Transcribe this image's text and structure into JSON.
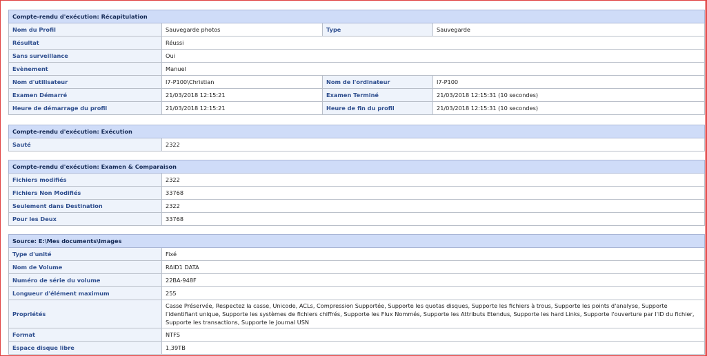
{
  "summary": {
    "header": "Compte-rendu d'exécution: Récapitulation",
    "rows": [
      {
        "l1": "Nom du Profil",
        "v1": "Sauvegarde photos",
        "l2": "Type",
        "v2": "Sauvegarde"
      },
      {
        "l1": "Résultat",
        "v1": "Réussi"
      },
      {
        "l1": "Sans surveillance",
        "v1": "Oui"
      },
      {
        "l1": "Evènement",
        "v1": "Manuel"
      },
      {
        "l1": "Nom d'utilisateur",
        "v1": "I7-P100\\Christian",
        "l2": "Nom de l'ordinateur",
        "v2": "I7-P100"
      },
      {
        "l1": "Examen Démarré",
        "v1": "21/03/2018 12:15:21",
        "l2": "Examen Terminé",
        "v2": "21/03/2018 12:15:31 (10 secondes)"
      },
      {
        "l1": "Heure de démarrage du profil",
        "v1": "21/03/2018 12:15:21",
        "l2": "Heure de fin du profil",
        "v2": "21/03/2018 12:15:31 (10 secondes)"
      }
    ]
  },
  "execution": {
    "header": "Compte-rendu d'exécution: Exécution",
    "rows": [
      {
        "l1": "Sauté",
        "v1": "2322"
      }
    ]
  },
  "compare": {
    "header": "Compte-rendu d'exécution: Examen & Comparaison",
    "rows": [
      {
        "l1": "Fichiers modifiés",
        "v1": "2322"
      },
      {
        "l1": "Fichiers Non Modifiés",
        "v1": "33768"
      },
      {
        "l1": "Seulement dans Destination",
        "v1": "2322"
      },
      {
        "l1": "Pour les Deux",
        "v1": "33768"
      }
    ]
  },
  "source": {
    "header": "Source: E:\\Mes documents\\Images",
    "rows": [
      {
        "l1": "Type d'unité",
        "v1": "Fixé"
      },
      {
        "l1": "Nom de Volume",
        "v1": "RAID1 DATA"
      },
      {
        "l1": "Numéro de série du volume",
        "v1": "22BA-948F"
      },
      {
        "l1": "Longueur d'élément maximum",
        "v1": "255"
      },
      {
        "l1": "Propriétés",
        "v1": "Casse Préservée, Respectez la casse, Unicode, ACLs, Compression Supportée, Supporte les quotas disques, Supporte les fichiers à trous, Supporte les points d'analyse, Supporte l'identifiant unique, Supporte les systèmes de fichiers chiffrés, Supporte les Flux Nommés, Supporte les Attributs Etendus, Supporte les hard Links, Supporte l'ouverture par l'ID du fichier, Supporte les transactions, Supporte le Journal USN",
        "multi": true
      },
      {
        "l1": "Format",
        "v1": "NTFS"
      },
      {
        "l1": "Espace disque libre",
        "v1": "1,39TB"
      }
    ]
  }
}
